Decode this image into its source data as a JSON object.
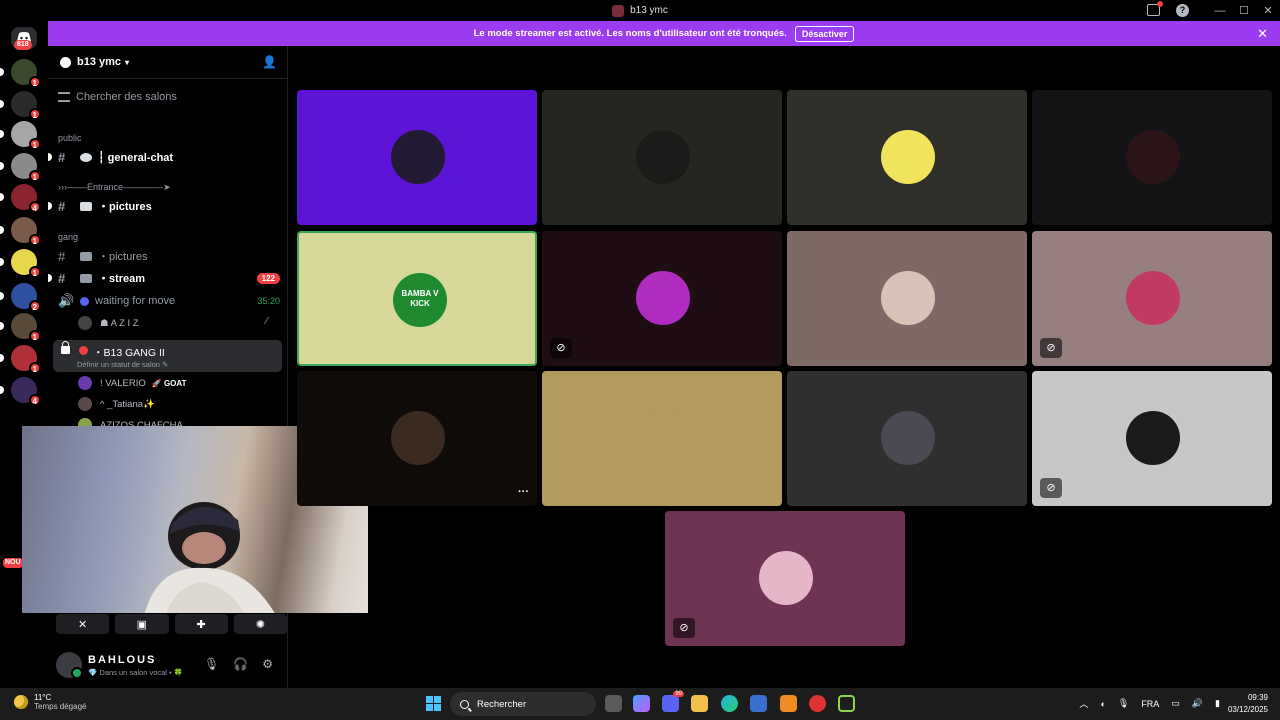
{
  "window": {
    "title": "b13 ymc"
  },
  "banner": {
    "message": "Le mode streamer est activé. Les noms d'utilisateur ont été tronqués.",
    "action": "Désactiver"
  },
  "home_badge": "818",
  "servers": [
    {
      "badge": "1",
      "color": "#3b4a2e"
    },
    {
      "badge": "1",
      "color": "#2a2a2a"
    },
    {
      "badge": "1",
      "color": "#a7a7a7"
    },
    {
      "badge": "1",
      "color": "#8a8a8a"
    },
    {
      "badge": "4",
      "color": "#8b2430"
    },
    {
      "badge": "1",
      "color": "#7a5a4a"
    },
    {
      "badge": "1",
      "color": "#e6d84a"
    },
    {
      "badge": "2",
      "color": "#3050a0"
    },
    {
      "badge": "1",
      "color": "#5a4a3a"
    },
    {
      "badge": "1",
      "color": "#b0303a"
    },
    {
      "badge": "4",
      "color": "#3a2a5a"
    }
  ],
  "nou_badge": "NOU",
  "guild": {
    "name": "b13 ymc"
  },
  "search": {
    "placeholder": "Chercher des salons"
  },
  "categories": {
    "public": "public",
    "entrance": "›››––––Entrance––––––––➤",
    "gang": "gang"
  },
  "channels": {
    "general_chat": "┆ general-chat",
    "pictures_entrance": "・pictures",
    "pictures_gang": "・pictures",
    "stream": "・stream",
    "stream_count": "122",
    "waiting": "waiting for move",
    "waiting_timer": "35:20",
    "waiting_member": "☗ A Z I Z",
    "active": "・B13 GANG II",
    "active_status": "Définir un statut de salon ✎"
  },
  "voice_members": [
    {
      "name": "! VALERIO",
      "tag": "🚀 GOAT",
      "color": "#6a3ab0"
    },
    {
      "name": "^ _Tatiana✨",
      "tag": "",
      "color": "#5a4a4a"
    },
    {
      "name": "AZIZOS CHAFCHA",
      "tag": "",
      "color": "#8aa34a"
    }
  ],
  "user": {
    "name": "BAHLOUS",
    "status": "💎 Dans un salon vocal • 🍀"
  },
  "tiles": [
    {
      "bg": "#5c14d6",
      "av": "#221a33",
      "muted": false
    },
    {
      "bg": "#262620",
      "av": "#1a1a18",
      "muted": false
    },
    {
      "bg": "#30302a",
      "av": "#f2e35c",
      "muted": false
    },
    {
      "bg": "#141416",
      "av": "#2a1418",
      "muted": false
    },
    {
      "bg": "#d6d89a",
      "av": "#1f8a2f",
      "muted": false,
      "speaking": true,
      "label": "BAMBA V KICK"
    },
    {
      "bg": "#1e0d12",
      "av": "#b02cc0",
      "muted": true
    },
    {
      "bg": "#7d6a65",
      "av": "#d8c3b8",
      "muted": false
    },
    {
      "bg": "#977f80",
      "av": "#c13a63",
      "muted": true
    },
    {
      "bg": "#0f0b08",
      "av": "#3a2a20",
      "muted": false,
      "more": true
    },
    {
      "bg": "#b39b5e",
      "av": "#b39b5e",
      "muted": false
    },
    {
      "bg": "#2f2f30",
      "av": "#4a4a52",
      "muted": false
    },
    {
      "bg": "#c7c7c7",
      "av": "#1a1a1a",
      "muted": true
    },
    {
      "bg": "#6e3453",
      "av": "#e4b6c7",
      "muted": true
    }
  ],
  "taskbar": {
    "temp": "11°C",
    "weather": "Temps dégagé",
    "search": "Rechercher",
    "lang": "FRA",
    "time": "09:39",
    "date": "03/12/2025",
    "discord_badge": "99"
  }
}
